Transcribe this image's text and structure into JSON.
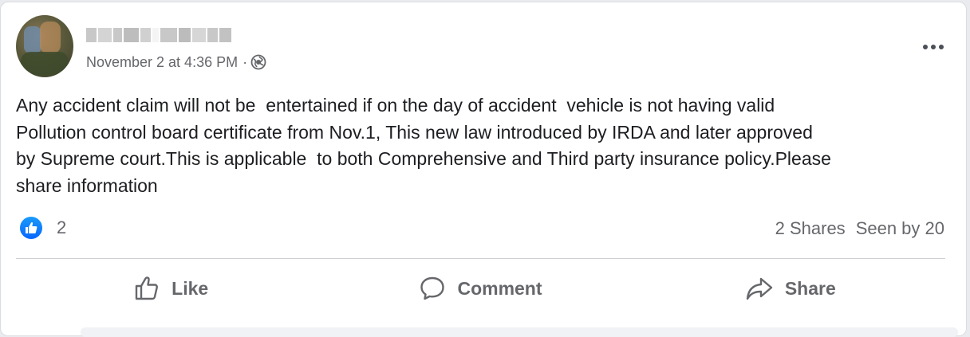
{
  "post": {
    "author": {
      "name": "",
      "avatar": "avatar"
    },
    "timestamp": "November 2 at 4:36 PM",
    "separator": "·",
    "audience_icon": "globe-icon",
    "menu_icon": "more-options-icon",
    "body": "Any accident claim will not be  entertained if on the day of accident  vehicle is not having valid\nPollution control board certificate from Nov.1, This new law introduced by IRDA and later approved\nby Supreme court.This is applicable  to both Comprehensive and Third party insurance policy.Please\nshare information",
    "reactions": {
      "icon": "like-reaction-icon",
      "count": "2"
    },
    "shares": "2 Shares",
    "seen_by": "Seen by 20"
  },
  "actions": {
    "like_label": "Like",
    "comment_label": "Comment",
    "share_label": "Share"
  },
  "colors": {
    "like_blue": "#0866ff",
    "muted_text": "#65676b",
    "body_text": "#1c1e21",
    "divider": "#ced0d4"
  }
}
